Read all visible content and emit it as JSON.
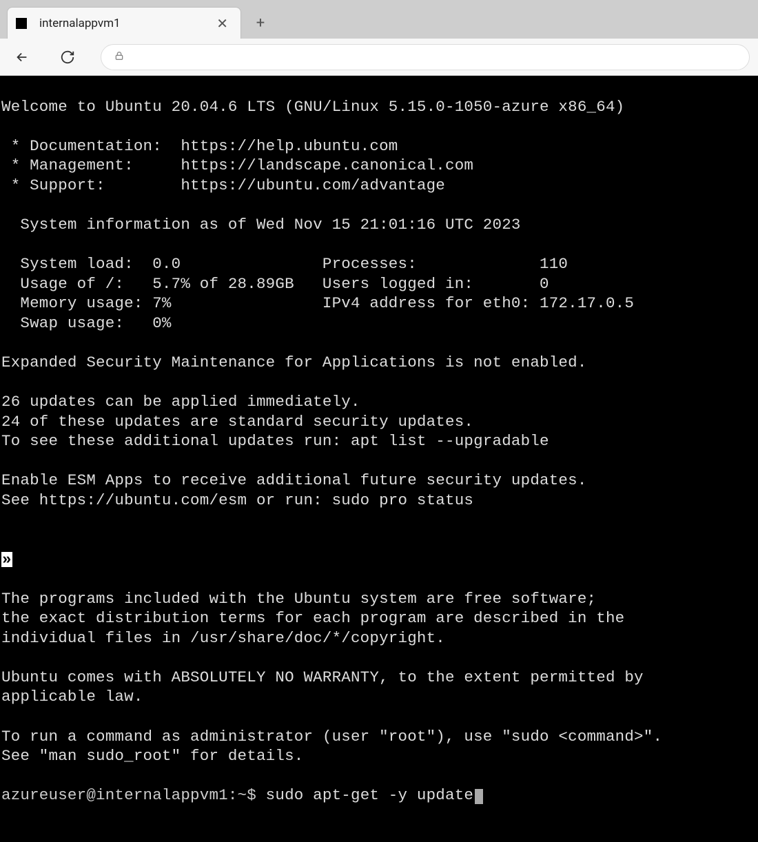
{
  "tab": {
    "title": "internalappvm1",
    "close_glyph": "✕",
    "new_tab_glyph": "+"
  },
  "terminal": {
    "welcome": "Welcome to Ubuntu 20.04.6 LTS (GNU/Linux 5.15.0-1050-azure x86_64)",
    "links": {
      "doc_label": " * Documentation:  https://help.ubuntu.com",
      "mgmt_label": " * Management:     https://landscape.canonical.com",
      "sup_label": " * Support:        https://ubuntu.com/advantage"
    },
    "sysinfo_header": "  System information as of Wed Nov 15 21:01:16 UTC 2023",
    "sysinfo": {
      "l1": "  System load:  0.0               Processes:             110",
      "l2": "  Usage of /:   5.7% of 28.89GB   Users logged in:       0",
      "l3": "  Memory usage: 7%                IPv4 address for eth0: 172.17.0.5",
      "l4": "  Swap usage:   0%"
    },
    "esm_line": "Expanded Security Maintenance for Applications is not enabled.",
    "updates1": "26 updates can be applied immediately.",
    "updates2": "24 of these updates are standard security updates.",
    "updates3": "To see these additional updates run: apt list --upgradable",
    "esm2a": "Enable ESM Apps to receive additional future security updates.",
    "esm2b": "See https://ubuntu.com/esm or run: sudo pro status",
    "chevron": "»",
    "legal1": "The programs included with the Ubuntu system are free software;",
    "legal2": "the exact distribution terms for each program are described in the",
    "legal3": "individual files in /usr/share/doc/*/copyright.",
    "warranty1": "Ubuntu comes with ABSOLUTELY NO WARRANTY, to the extent permitted by",
    "warranty2": "applicable law.",
    "sudo1": "To run a command as administrator (user \"root\"), use \"sudo <command>\".",
    "sudo2": "See \"man sudo_root\" for details.",
    "prompt": "azureuser@internalappvm1:~$ ",
    "command": "sudo apt-get -y update"
  }
}
